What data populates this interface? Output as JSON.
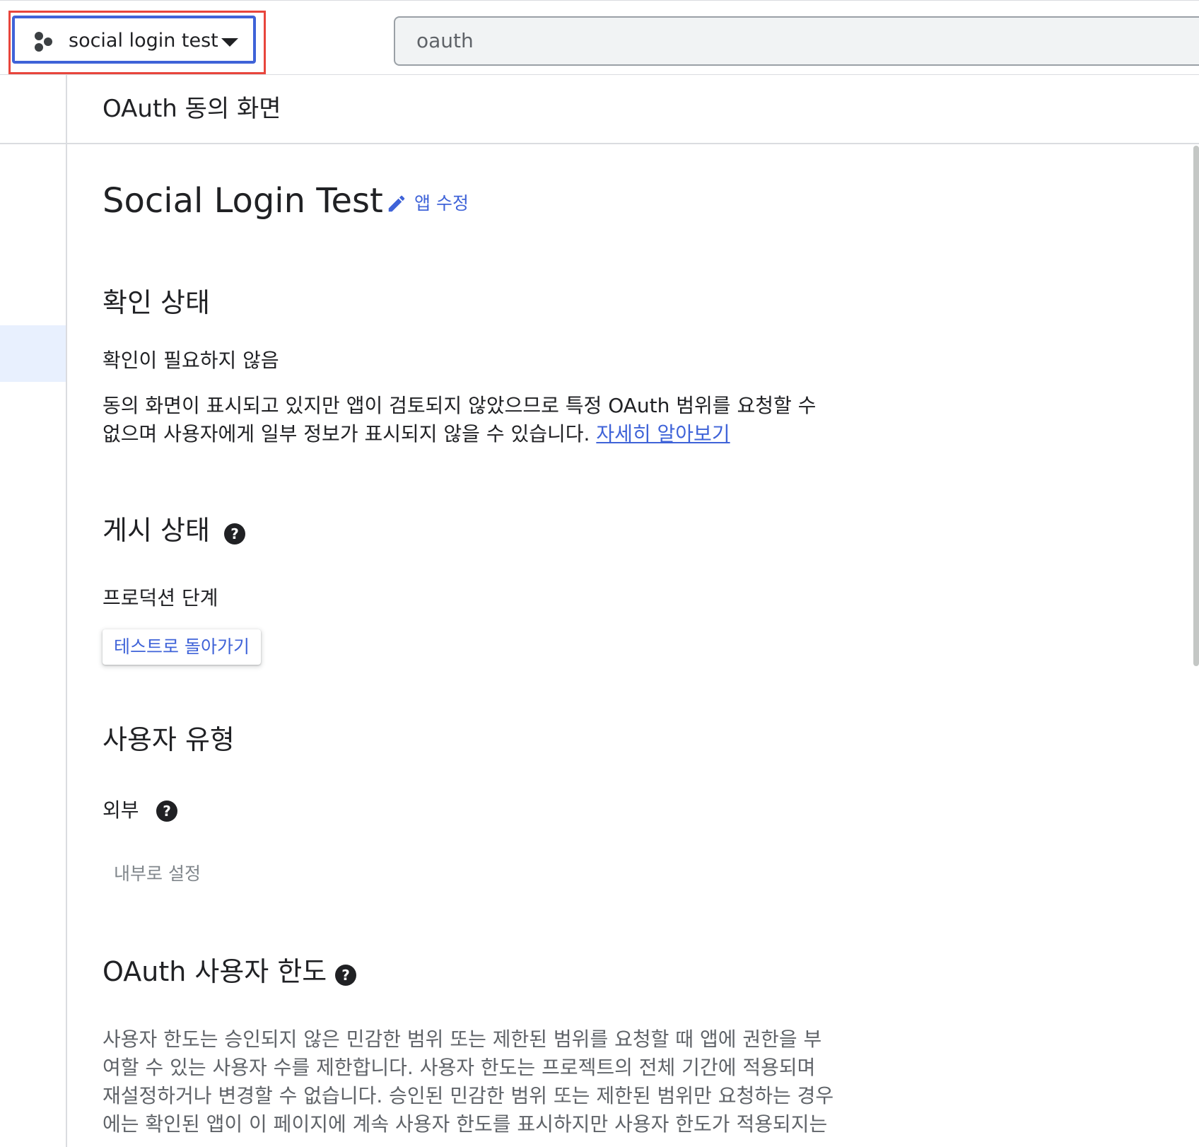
{
  "topbar": {
    "project_name": "social login test",
    "search_value": "oauth"
  },
  "page": {
    "title": "OAuth 동의 화면"
  },
  "app": {
    "name": "Social Login Test",
    "edit_label": "앱 수정"
  },
  "verification": {
    "title": "확인 상태",
    "status": "확인이 필요하지 않음",
    "description_line1": "동의 화면이 표시되고 있지만 앱이 검토되지 않았으므로 특정 OAuth 범위를 요청할 수",
    "description_line2": "없으며 사용자에게 일부 정보가 표시되지 않을 수 있습니다.",
    "learn_more": "자세히 알아보기"
  },
  "publishing": {
    "title": "게시 상태",
    "status": "프로덕션 단계",
    "back_button": "테스트로 돌아가기"
  },
  "user_type": {
    "title": "사용자 유형",
    "value": "외부",
    "set_internal_button": "내부로 설정"
  },
  "user_cap": {
    "title": "OAuth 사용자 한도",
    "line1": "사용자 한도는 승인되지 않은 민감한 범위 또는 제한된 범위를 요청할 때 앱에 권한을 부",
    "line2": "여할 수 있는 사용자 수를 제한합니다. 사용자 한도는 프로젝트의 전체 기간에 적용되며",
    "line3": "재설정하거나 변경할 수 없습니다. 승인된 민감한 범위 또는 제한된 범위만 요청하는 경우",
    "line4": "에는 확인된 앱이 이 페이지에 계속 사용자 한도를 표시하지만 사용자 한도가 적용되지는"
  },
  "icons": {
    "project": "project-hexagons-icon",
    "caret": "caret-down-icon",
    "edit": "pencil-icon",
    "help": "help-circle-icon"
  },
  "colors": {
    "accent": "#3f63d8",
    "highlight": "#e8453c",
    "text": "#202124",
    "muted": "#5f6368"
  }
}
